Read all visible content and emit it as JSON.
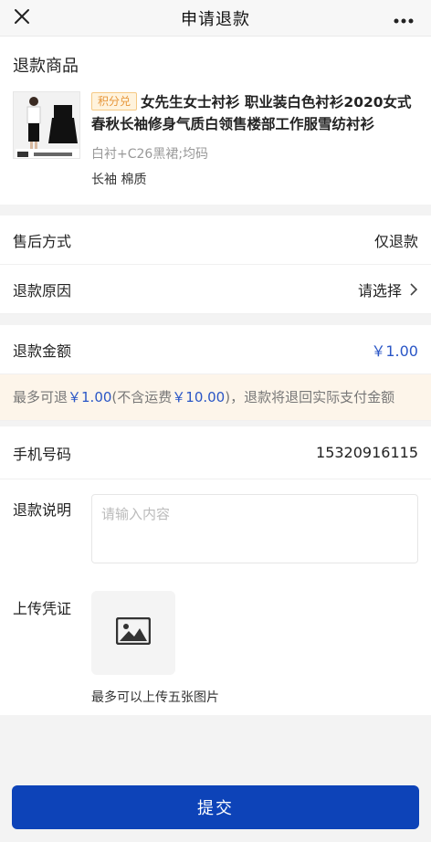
{
  "header": {
    "title": "申请退款",
    "close_icon": "close-icon",
    "more_icon": "more-icon"
  },
  "product": {
    "section_title": "退款商品",
    "tag": "积分兑",
    "title": "女先生女士衬衫 职业装白色衬衫2020女式春秋长袖修身气质白领售楼部工作服雪纺衬衫",
    "spec": "白衬+C26黑裙;均码",
    "attributes": "长袖 棉质"
  },
  "after_sale": {
    "label": "售后方式",
    "value": "仅退款"
  },
  "reason": {
    "label": "退款原因",
    "placeholder": "请选择",
    "chevron_icon": "chevron-right-icon"
  },
  "amount": {
    "label": "退款金额",
    "value": "￥1.00"
  },
  "notice": {
    "prefix": "最多可退",
    "max_refund": "￥1.00",
    "middle": "(不含运费",
    "shipping": "￥10.00",
    "suffix": ")，退款将退回实际支付金额"
  },
  "phone": {
    "label": "手机号码",
    "value": "15320916115"
  },
  "description": {
    "label": "退款说明",
    "placeholder": "请输入内容"
  },
  "upload": {
    "label": "上传凭证",
    "icon": "image-icon",
    "hint": "最多可以上传五张图片"
  },
  "submit": {
    "label": "提交"
  },
  "colors": {
    "primary": "#0d43b8",
    "accent_blue": "#2a56c6",
    "tag_orange": "#e7963a",
    "notice_bg": "#fdf5ea"
  }
}
